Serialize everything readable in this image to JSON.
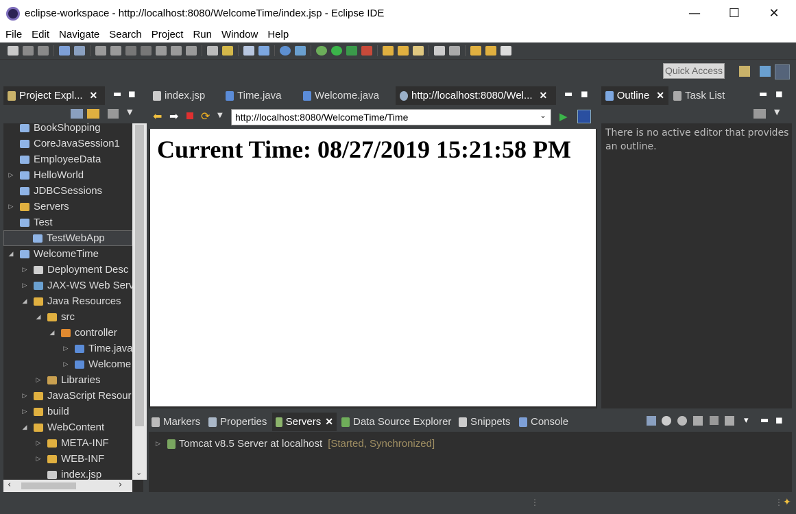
{
  "window": {
    "title": "eclipse-workspace - http://localhost:8080/WelcomeTime/index.jsp - Eclipse IDE",
    "minimize": "—",
    "maximize": "☐",
    "close": "✕"
  },
  "menu": [
    "File",
    "Edit",
    "Navigate",
    "Search",
    "Project",
    "Run",
    "Window",
    "Help"
  ],
  "quick_access": {
    "placeholder": "Quick Access"
  },
  "project_explorer": {
    "tab_label": "Project Expl...",
    "items": [
      {
        "label": "BookShopping",
        "indent": 0,
        "twisty": "",
        "icon": "folder"
      },
      {
        "label": "CoreJavaSession1",
        "indent": 0,
        "twisty": "",
        "icon": "folder"
      },
      {
        "label": "EmployeeData",
        "indent": 0,
        "twisty": "",
        "icon": "folder"
      },
      {
        "label": "HelloWorld",
        "indent": 0,
        "twisty": "▷",
        "icon": "web-project"
      },
      {
        "label": "JDBCSessions",
        "indent": 0,
        "twisty": "",
        "icon": "folder"
      },
      {
        "label": "Servers",
        "indent": 0,
        "twisty": "▷",
        "icon": "folder-open"
      },
      {
        "label": "Test",
        "indent": 0,
        "twisty": "",
        "icon": "folder"
      },
      {
        "label": "TestWebApp",
        "indent": 0,
        "twisty": "",
        "icon": "folder",
        "selected": true
      },
      {
        "label": "WelcomeTime",
        "indent": 0,
        "twisty": "◢",
        "icon": "web-project"
      },
      {
        "label": "Deployment Desc",
        "indent": 1,
        "twisty": "▷",
        "icon": "descriptor"
      },
      {
        "label": "JAX-WS Web Serv",
        "indent": 1,
        "twisty": "▷",
        "icon": "webservice"
      },
      {
        "label": "Java Resources",
        "indent": 1,
        "twisty": "◢",
        "icon": "java-resources"
      },
      {
        "label": "src",
        "indent": 2,
        "twisty": "◢",
        "icon": "src-folder"
      },
      {
        "label": "controller",
        "indent": 3,
        "twisty": "◢",
        "icon": "package"
      },
      {
        "label": "Time.java",
        "indent": 4,
        "twisty": "▷",
        "icon": "java-file"
      },
      {
        "label": "Welcome",
        "indent": 4,
        "twisty": "▷",
        "icon": "java-file"
      },
      {
        "label": "Libraries",
        "indent": 2,
        "twisty": "▷",
        "icon": "library"
      },
      {
        "label": "JavaScript Resour",
        "indent": 1,
        "twisty": "▷",
        "icon": "js-resources"
      },
      {
        "label": "build",
        "indent": 1,
        "twisty": "▷",
        "icon": "folder-open"
      },
      {
        "label": "WebContent",
        "indent": 1,
        "twisty": "◢",
        "icon": "folder-open"
      },
      {
        "label": "META-INF",
        "indent": 2,
        "twisty": "▷",
        "icon": "folder-open"
      },
      {
        "label": "WEB-INF",
        "indent": 2,
        "twisty": "▷",
        "icon": "folder-open"
      },
      {
        "label": "index.jsp",
        "indent": 2,
        "twisty": "",
        "icon": "jsp-file"
      }
    ]
  },
  "editor_tabs": [
    {
      "label": "index.jsp",
      "icon": "jsp-file"
    },
    {
      "label": "Time.java",
      "icon": "java-file"
    },
    {
      "label": "Welcome.java",
      "icon": "java-file"
    },
    {
      "label": "http://localhost:8080/Wel...",
      "icon": "globe",
      "active": true
    }
  ],
  "browser": {
    "url": "http://localhost:8080/WelcomeTime/Time",
    "content_heading": "Current Time: 08/27/2019 15:21:58 PM"
  },
  "outline": {
    "tab_label": "Outline",
    "task_tab_label": "Task List",
    "message": "There is no active editor that provides an outline."
  },
  "bottom_tabs": [
    {
      "label": "Markers",
      "icon": "markers"
    },
    {
      "label": "Properties",
      "icon": "properties"
    },
    {
      "label": "Servers",
      "icon": "servers",
      "active": true
    },
    {
      "label": "Data Source Explorer",
      "icon": "data-source"
    },
    {
      "label": "Snippets",
      "icon": "snippets"
    },
    {
      "label": "Console",
      "icon": "console"
    }
  ],
  "servers": [
    {
      "name": "Tomcat v8.5 Server at localhost",
      "status": "[Started, Synchronized]"
    }
  ],
  "colors": {
    "background": "#3c3f41",
    "panel": "#2f2f2f",
    "status_text": "#9f8e62",
    "folder": "#8fb4e6",
    "java": "#5b8cd8"
  }
}
